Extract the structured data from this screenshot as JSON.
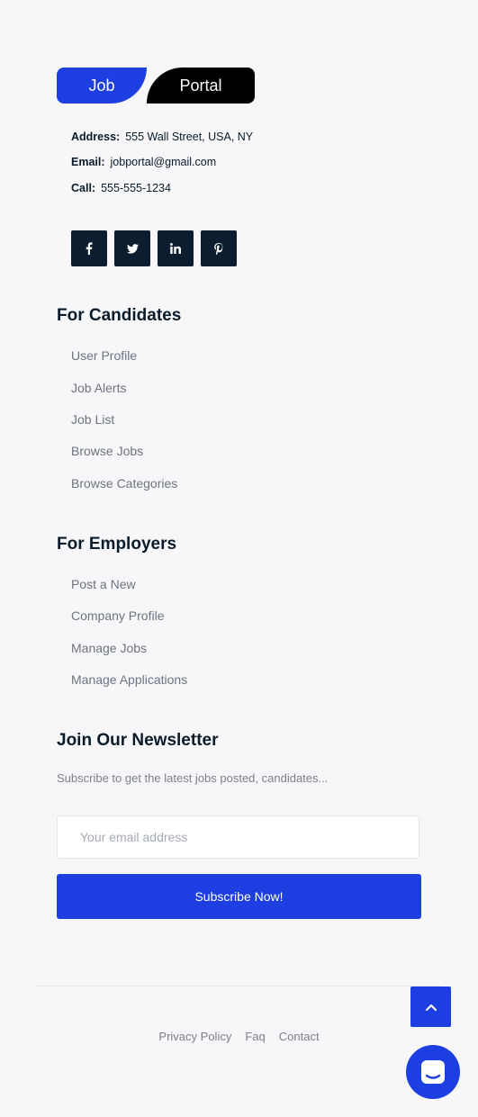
{
  "brand": {
    "part1": "Job",
    "part2": "Portal"
  },
  "contact": {
    "address_label": "Address:",
    "address": "555 Wall Street, USA, NY",
    "email_label": "Email:",
    "email": "jobportal@gmail.com",
    "call_label": "Call:",
    "call": "555-555-1234"
  },
  "social": {
    "facebook": "f",
    "twitter": "t",
    "linkedin": "in",
    "pinterest": "p"
  },
  "candidates": {
    "title": "For Candidates",
    "links": [
      "User Profile",
      "Job Alerts",
      "Job List",
      "Browse Jobs",
      "Browse Categories"
    ]
  },
  "employers": {
    "title": "For Employers",
    "links": [
      "Post a New",
      "Company Profile",
      "Manage Jobs",
      "Manage Applications"
    ]
  },
  "newsletter": {
    "title": "Join Our Newsletter",
    "subtitle": "Subscribe to get the latest jobs posted, candidates...",
    "placeholder": "Your email address",
    "button": "Subscribe Now!"
  },
  "footer": {
    "links": [
      "Privacy Policy",
      "Faq",
      "Contact"
    ]
  },
  "colors": {
    "accent": "#1d3ee0",
    "dark": "#0b1d2f",
    "background": "#f7f7f9"
  }
}
